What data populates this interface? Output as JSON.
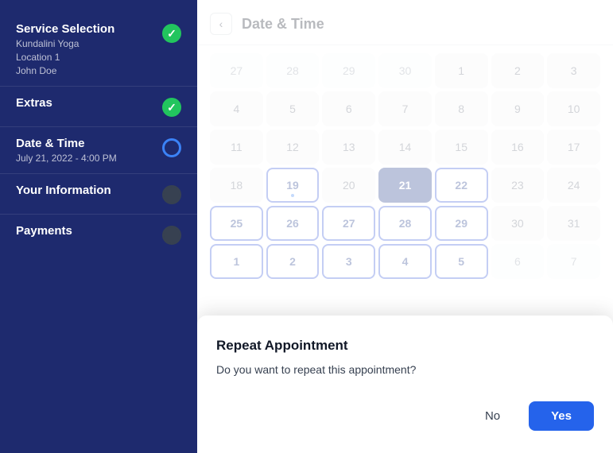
{
  "sidebar": {
    "items": [
      {
        "id": "service-selection",
        "title": "Service Selection",
        "subtitles": [
          "Kundalini Yoga",
          "Location 1",
          "John Doe"
        ],
        "icon": "check",
        "icon_style": "green"
      },
      {
        "id": "extras",
        "title": "Extras",
        "subtitles": [],
        "icon": "check",
        "icon_style": "green"
      },
      {
        "id": "date-time",
        "title": "Date & Time",
        "subtitles": [
          "July 21, 2022 - 4:00 PM"
        ],
        "icon": "ring",
        "icon_style": "blue-ring"
      },
      {
        "id": "your-information",
        "title": "Your Information",
        "subtitles": [],
        "icon": "dot",
        "icon_style": "dark"
      },
      {
        "id": "payments",
        "title": "Payments",
        "subtitles": [],
        "icon": "dot",
        "icon_style": "dark"
      }
    ]
  },
  "header": {
    "back_label": "‹",
    "title": "Date & Time"
  },
  "calendar": {
    "time_label": "July 21, 2022 - 4:00 PM",
    "weeks": [
      [
        {
          "day": "27",
          "month": "other"
        },
        {
          "day": "28",
          "month": "other"
        },
        {
          "day": "29",
          "month": "other"
        },
        {
          "day": "30",
          "month": "other"
        },
        {
          "day": "1",
          "month": "current"
        },
        {
          "day": "2",
          "month": "current"
        },
        {
          "day": "3",
          "month": "current"
        }
      ],
      [
        {
          "day": "4",
          "month": "current"
        },
        {
          "day": "5",
          "month": "current"
        },
        {
          "day": "6",
          "month": "current"
        },
        {
          "day": "7",
          "month": "current"
        },
        {
          "day": "8",
          "month": "current"
        },
        {
          "day": "9",
          "month": "current"
        },
        {
          "day": "10",
          "month": "current"
        }
      ],
      [
        {
          "day": "11",
          "month": "current"
        },
        {
          "day": "12",
          "month": "current"
        },
        {
          "day": "13",
          "month": "current"
        },
        {
          "day": "14",
          "month": "current"
        },
        {
          "day": "15",
          "month": "current"
        },
        {
          "day": "16",
          "month": "current"
        },
        {
          "day": "17",
          "month": "current"
        }
      ],
      [
        {
          "day": "18",
          "month": "current"
        },
        {
          "day": "19",
          "month": "current",
          "state": "highlighted",
          "dot": true
        },
        {
          "day": "20",
          "month": "current"
        },
        {
          "day": "21",
          "month": "current",
          "state": "selected"
        },
        {
          "day": "22",
          "month": "current",
          "state": "highlighted"
        },
        {
          "day": "23",
          "month": "current"
        },
        {
          "day": "24",
          "month": "current"
        }
      ],
      [
        {
          "day": "25",
          "month": "current",
          "state": "highlighted"
        },
        {
          "day": "26",
          "month": "current",
          "state": "highlighted"
        },
        {
          "day": "27",
          "month": "current",
          "state": "highlighted"
        },
        {
          "day": "28",
          "month": "current",
          "state": "highlighted"
        },
        {
          "day": "29",
          "month": "current",
          "state": "highlighted"
        },
        {
          "day": "30",
          "month": "current"
        },
        {
          "day": "31",
          "month": "current"
        }
      ],
      [
        {
          "day": "1",
          "month": "next",
          "state": "highlighted"
        },
        {
          "day": "2",
          "month": "next",
          "state": "highlighted"
        },
        {
          "day": "3",
          "month": "next",
          "state": "highlighted"
        },
        {
          "day": "4",
          "month": "next",
          "state": "highlighted"
        },
        {
          "day": "5",
          "month": "next",
          "state": "highlighted"
        },
        {
          "day": "6",
          "month": "next"
        },
        {
          "day": "7",
          "month": "next"
        }
      ]
    ]
  },
  "modal": {
    "title": "Repeat Appointment",
    "body": "Do you want to repeat this appointment?",
    "no_label": "No",
    "yes_label": "Yes"
  }
}
